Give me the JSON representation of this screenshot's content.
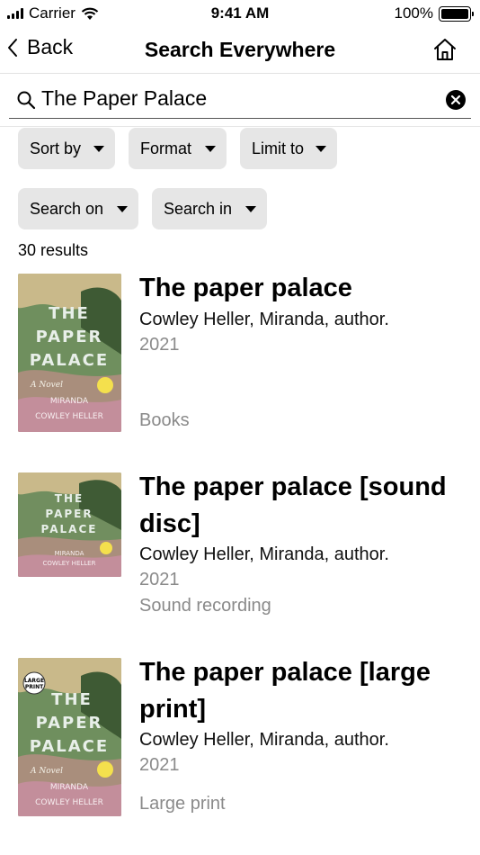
{
  "status": {
    "carrier": "Carrier",
    "time": "9:41 AM",
    "battery": "100%"
  },
  "nav": {
    "back_label": "Back",
    "title": "Search Everywhere"
  },
  "search": {
    "query": "The Paper Palace"
  },
  "filters": [
    {
      "label": "Sort by"
    },
    {
      "label": "Format"
    },
    {
      "label": "Limit to"
    },
    {
      "label": "Search on"
    },
    {
      "label": "Search in"
    }
  ],
  "results_count": "30 results",
  "results": [
    {
      "title": "The paper palace",
      "author": "Cowley Heller, Miranda, author.",
      "year": "2021",
      "format": "Books",
      "cover": {
        "line1": "THE",
        "line2": "PAPER",
        "line3": "PALACE",
        "subtitle": "A Novel",
        "author1": "MIRANDA",
        "author2": "COWLEY HELLER"
      }
    },
    {
      "title": "The paper palace [sound disc]",
      "author": "Cowley Heller, Miranda, author.",
      "year": "2021",
      "format": "Sound recording",
      "cover": {
        "line1": "THE",
        "line2": "PAPER",
        "line3": "PALACE",
        "author1": "MIRANDA",
        "author2": "COWLEY HELLER"
      }
    },
    {
      "title": "The paper palace [large print]",
      "author": "Cowley Heller, Miranda, author.",
      "year": "2021",
      "format": "Large print",
      "cover": {
        "badge1": "LARGE",
        "badge2": "PRINT",
        "line1": "THE",
        "line2": "PAPER",
        "line3": "PALACE",
        "subtitle": "A Novel",
        "author1": "MIRANDA",
        "author2": "COWLEY HELLER"
      }
    }
  ]
}
